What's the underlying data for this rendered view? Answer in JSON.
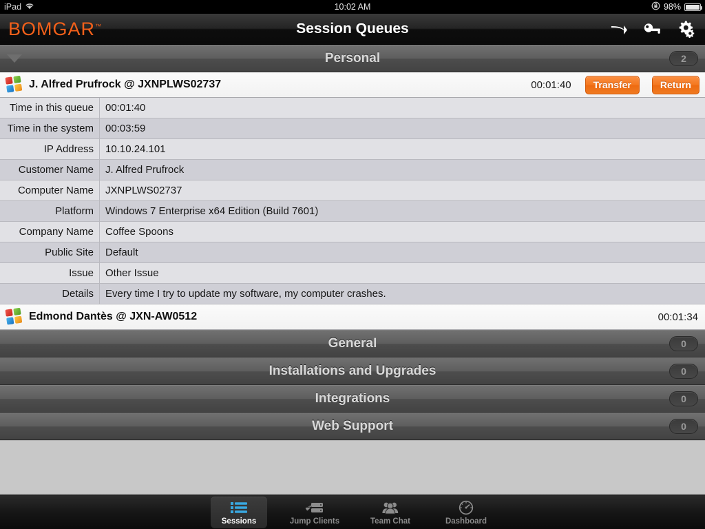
{
  "statusbar": {
    "device": "iPad",
    "wifi_icon": "wifi-icon",
    "time": "10:02 AM",
    "lock_icon": "rotation-lock-icon",
    "battery_percent": "98%",
    "battery_icon": "battery-icon"
  },
  "navbar": {
    "logo_text": "BOMGAR",
    "logo_tm": "™",
    "logo_color": "#f2601a",
    "title": "Session Queues",
    "actions": [
      {
        "name": "jump-to-icon",
        "label": "Jump To"
      },
      {
        "name": "key-icon",
        "label": "Credentials"
      },
      {
        "name": "gears-icon",
        "label": "Settings"
      }
    ]
  },
  "queues": [
    {
      "name": "Personal",
      "count": "2",
      "expanded": true,
      "disclosure_icon": "chevron-down-triangle-icon"
    },
    {
      "name": "General",
      "count": "0",
      "expanded": false
    },
    {
      "name": "Installations and Upgrades",
      "count": "0",
      "expanded": false
    },
    {
      "name": "Integrations",
      "count": "0",
      "expanded": false
    },
    {
      "name": "Web Support",
      "count": "0",
      "expanded": false
    }
  ],
  "sessions": [
    {
      "platform_icon": "windows-logo-icon",
      "title": "J. Alfred Prufrock @ JXNPLWS02737",
      "timer": "00:01:40",
      "buttons": {
        "transfer": "Transfer",
        "return": "Return"
      },
      "expanded": true
    },
    {
      "platform_icon": "windows-logo-icon",
      "title": "Edmond Dantès @ JXN-AW0512",
      "timer": "00:01:34",
      "expanded": false
    }
  ],
  "detail_rows": [
    {
      "label": "Time in this queue",
      "value": "00:01:40"
    },
    {
      "label": "Time in the system",
      "value": "00:03:59"
    },
    {
      "label": "IP Address",
      "value": "10.10.24.101"
    },
    {
      "label": "Customer Name",
      "value": "J. Alfred Prufrock"
    },
    {
      "label": "Computer Name",
      "value": "JXNPLWS02737"
    },
    {
      "label": "Platform",
      "value": "Windows 7 Enterprise x64 Edition (Build 7601)"
    },
    {
      "label": "Company Name",
      "value": "Coffee Spoons"
    },
    {
      "label": "Public Site",
      "value": "Default"
    },
    {
      "label": "Issue",
      "value": "Other Issue"
    },
    {
      "label": "Details",
      "value": "Every time I try to update my software, my computer crashes."
    }
  ],
  "tabbar": {
    "selected": "Sessions",
    "tabs": [
      {
        "label": "Sessions",
        "icon": "list-lines-icon",
        "selected": true
      },
      {
        "label": "Jump Clients",
        "icon": "server-arrow-icon",
        "selected": false
      },
      {
        "label": "Team Chat",
        "icon": "people-group-icon",
        "selected": false
      },
      {
        "label": "Dashboard",
        "icon": "gauge-icon",
        "selected": false
      }
    ]
  },
  "colors": {
    "brand_orange": "#f2601a",
    "button_orange": "#f4781f",
    "tab_selected_blue": "#39a8e0"
  }
}
